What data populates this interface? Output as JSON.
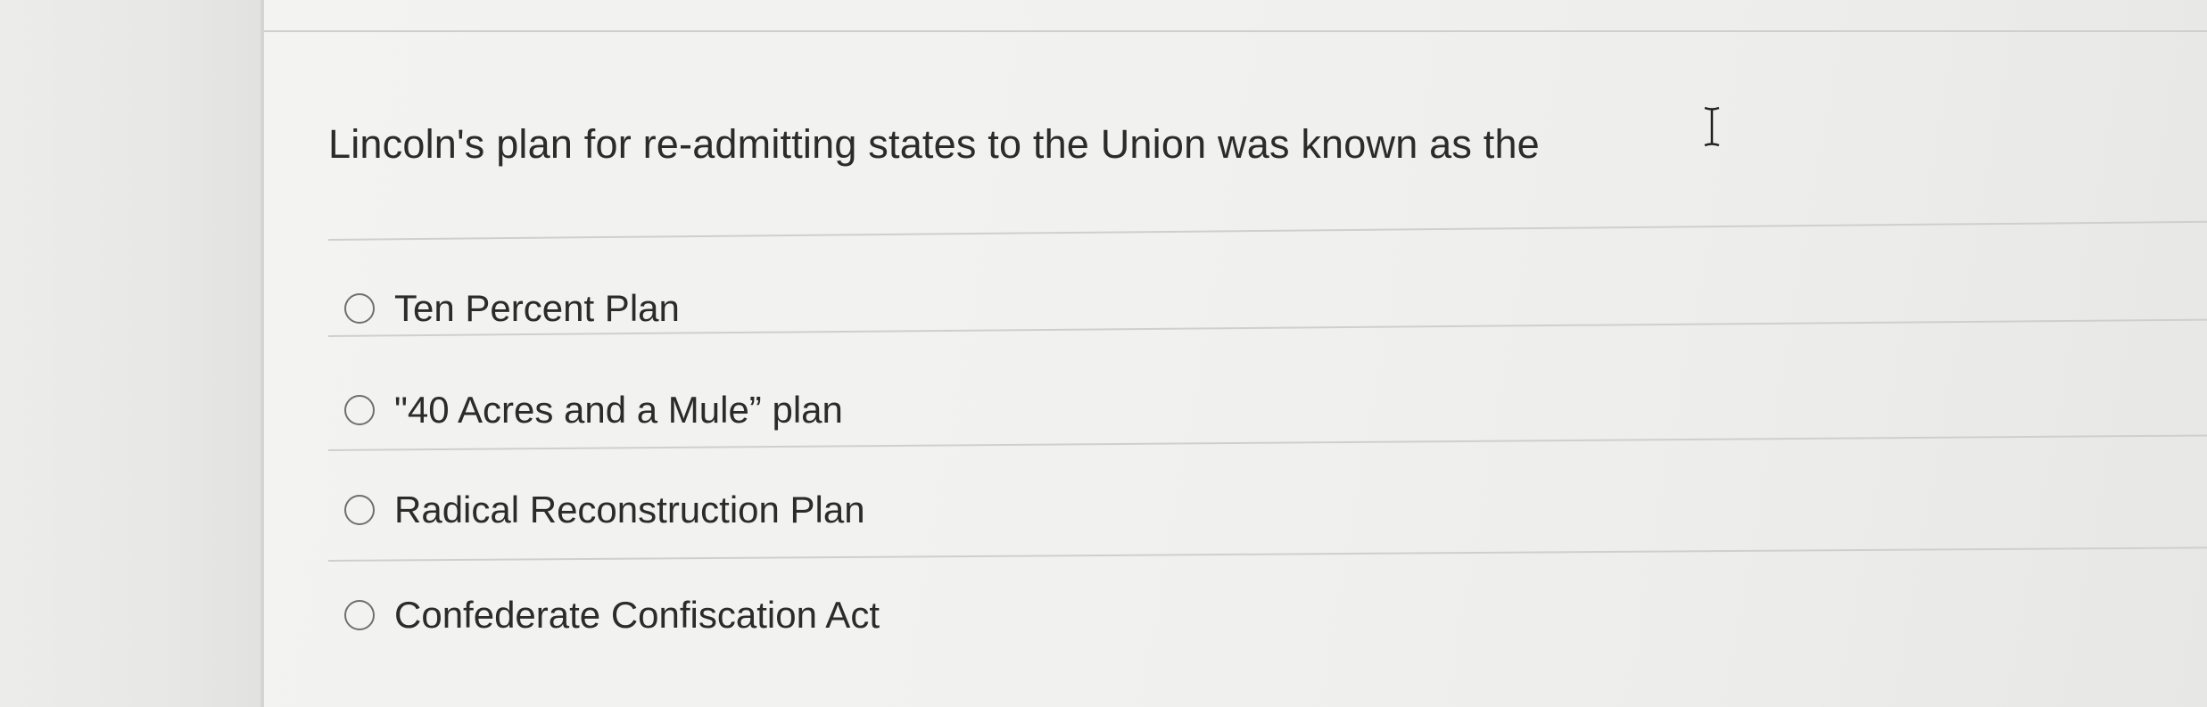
{
  "question": {
    "text": "Lincoln's plan for re-admitting states to the Union was known as the"
  },
  "options": [
    {
      "label": "Ten Percent Plan",
      "selected": false
    },
    {
      "label": "\"40 Acres and a Mule” plan",
      "selected": false
    },
    {
      "label": "Radical Reconstruction Plan",
      "selected": false
    },
    {
      "label": "Confederate Confiscation Act",
      "selected": false
    }
  ],
  "cursor": {
    "icon": "text-cursor-icon"
  }
}
